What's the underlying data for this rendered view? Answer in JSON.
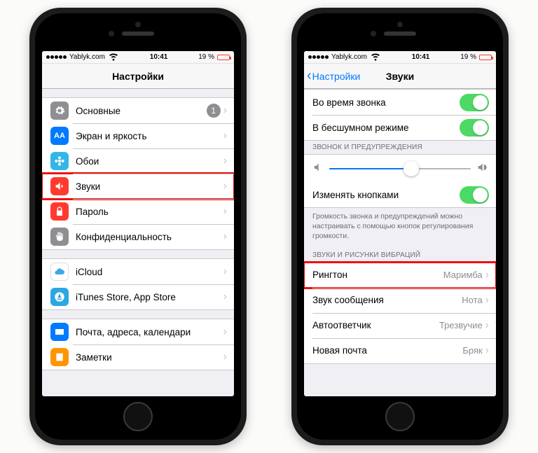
{
  "status": {
    "carrier": "Yablyk.com",
    "time": "10:41",
    "battery_pct": "19 %"
  },
  "left_screen": {
    "title": "Настройки",
    "groups": [
      {
        "items": [
          {
            "key": "general",
            "icon": "gear",
            "color": "ic-gray",
            "label": "Основные",
            "badge": "1"
          },
          {
            "key": "display",
            "icon": "textsize",
            "color": "ic-blue",
            "label": "Экран и яркость"
          },
          {
            "key": "wallpaper",
            "icon": "flower",
            "color": "ic-cyan",
            "label": "Обои"
          },
          {
            "key": "sounds",
            "icon": "speaker",
            "color": "ic-red",
            "label": "Звуки",
            "highlight": true
          },
          {
            "key": "passcode",
            "icon": "lock",
            "color": "ic-red",
            "label": "Пароль"
          },
          {
            "key": "privacy",
            "icon": "hand",
            "color": "ic-gray",
            "label": "Конфиденциальность"
          }
        ]
      },
      {
        "items": [
          {
            "key": "icloud",
            "icon": "cloud",
            "color": "ic-white",
            "label": "iCloud"
          },
          {
            "key": "itunes",
            "icon": "appstore",
            "color": "ic-sky",
            "label": "iTunes Store, App Store"
          }
        ]
      },
      {
        "items": [
          {
            "key": "mail",
            "icon": "mail",
            "color": "ic-blue",
            "label": "Почта, адреса, календари"
          },
          {
            "key": "notes",
            "icon": "notes",
            "color": "ic-orange",
            "label": "Заметки"
          }
        ]
      }
    ]
  },
  "right_screen": {
    "back_label": "Настройки",
    "title": "Звуки",
    "vibrate": {
      "ring": "Во время звонка",
      "silent": "В бесшумном режиме"
    },
    "ringer_header": "ЗВОНОК И ПРЕДУПРЕЖДЕНИЯ",
    "slider_value_pct": 58,
    "change_with_buttons": "Изменять кнопками",
    "ringer_footer": "Громкость звонка и предупреждений можно настраивать с помощью кнопок регулирования громкости.",
    "sounds_header": "ЗВУКИ И РИСУНКИ ВИБРАЦИЙ",
    "sounds": [
      {
        "key": "ringtone",
        "label": "Рингтон",
        "value": "Маримба",
        "highlight": true
      },
      {
        "key": "text",
        "label": "Звук сообщения",
        "value": "Нота"
      },
      {
        "key": "voicemail",
        "label": "Автоответчик",
        "value": "Трезвучие"
      },
      {
        "key": "newmail",
        "label": "Новая почта",
        "value": "Бряк"
      }
    ]
  }
}
